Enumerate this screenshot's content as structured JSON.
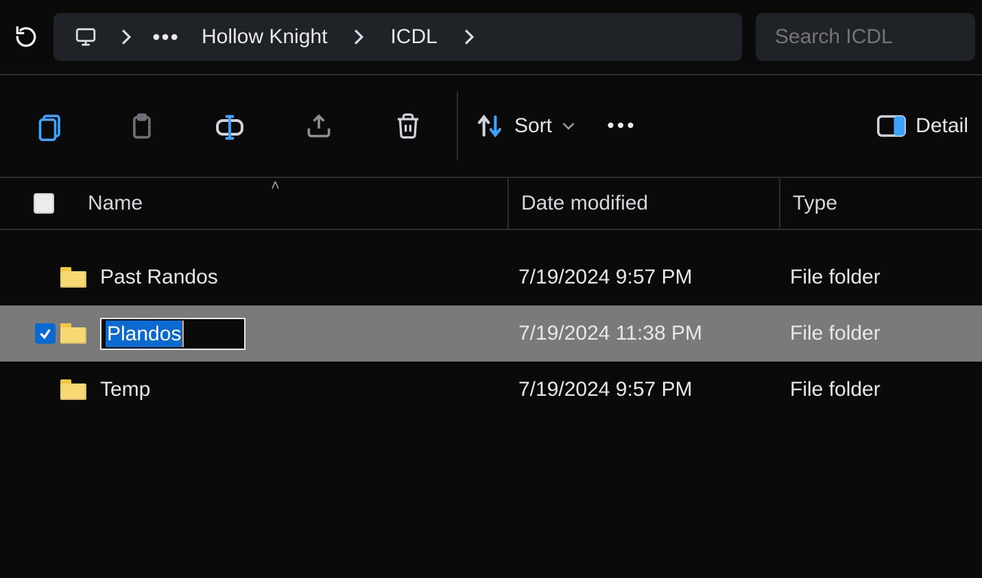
{
  "breadcrumb": {
    "segments": [
      "Hollow Knight",
      "ICDL"
    ]
  },
  "search": {
    "placeholder": "Search ICDL"
  },
  "toolbar": {
    "sort_label": "Sort",
    "view_label": "Detail"
  },
  "columns": {
    "name": "Name",
    "date": "Date modified",
    "type": "Type"
  },
  "rows": [
    {
      "name": "Past Randos",
      "date": "7/19/2024 9:57 PM",
      "type": "File folder",
      "selected": false,
      "renaming": false
    },
    {
      "name": "Plandos",
      "date": "7/19/2024 11:38 PM",
      "type": "File folder",
      "selected": true,
      "renaming": true
    },
    {
      "name": "Temp",
      "date": "7/19/2024 9:57 PM",
      "type": "File folder",
      "selected": false,
      "renaming": false
    }
  ]
}
